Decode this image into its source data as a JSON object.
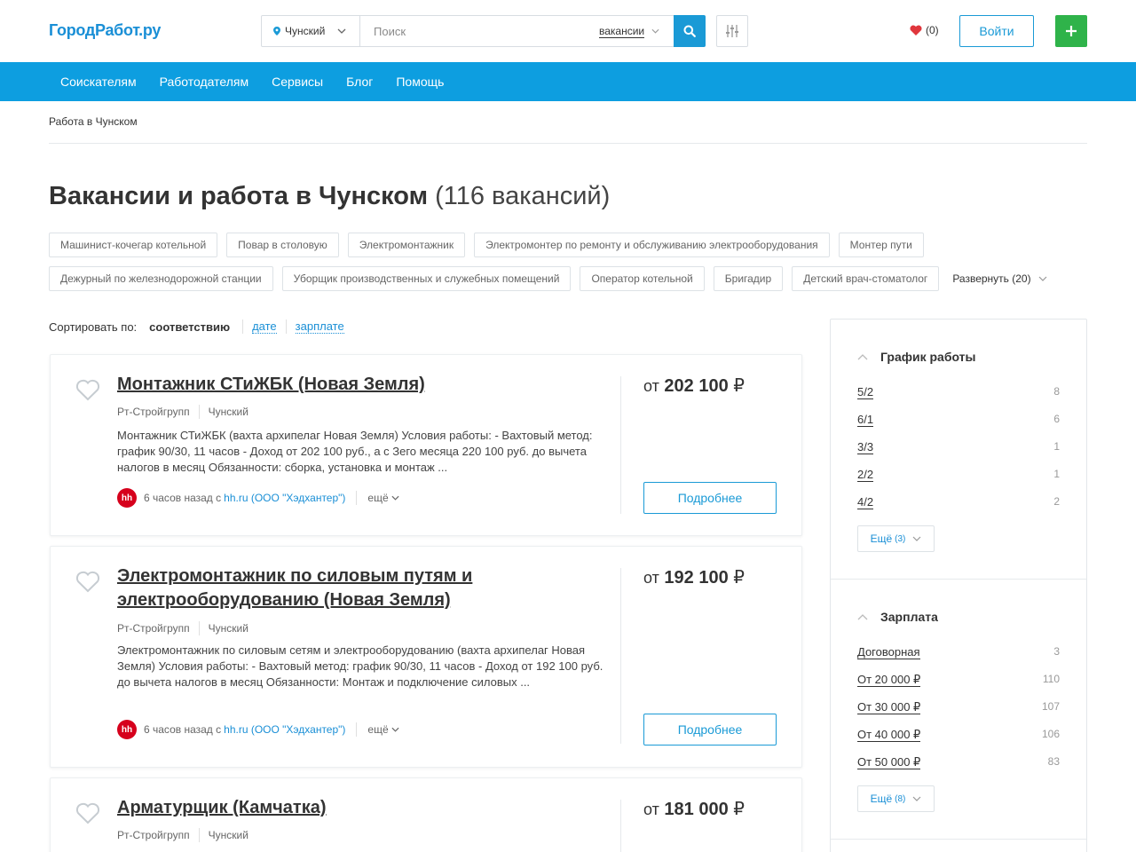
{
  "header": {
    "logo": "ГородРабот.ру",
    "city": "Чунский",
    "search_placeholder": "Поиск",
    "search_type": "вакансии",
    "favorites_count": "(0)",
    "login_label": "Войти",
    "colors": {
      "brand": "#1a9ad6",
      "add": "#2fb34a",
      "heart": "#e0363c"
    }
  },
  "nav": {
    "items": [
      "Соискателям",
      "Работодателям",
      "Сервисы",
      "Блог",
      "Помощь"
    ]
  },
  "breadcrumb": "Работа в Чунском",
  "page": {
    "title": "Вакансии и работа в Чунском",
    "count": "(116 вакансий)"
  },
  "tags": {
    "row1": [
      "Машинист-кочегар котельной",
      "Повар в столовую",
      "Электромонтажник",
      "Электромонтер по ремонту и обслуживанию электрооборудования",
      "Монтер пути"
    ],
    "row2": [
      "Дежурный по железнодорожной станции",
      "Уборщик производственных и служебных помещений",
      "Оператор котельной",
      "Бригадир",
      "Детский врач-стоматолог"
    ],
    "expand_label": "Развернуть (20)"
  },
  "sort": {
    "label": "Сортировать по:",
    "active": "соответствию",
    "options": [
      "дате",
      "зарплате"
    ]
  },
  "vacancies": [
    {
      "title": "Монтажник СТиЖБК (Новая Земля)",
      "company": "Рт-Стройгрупп",
      "city": "Чунский",
      "description": "Монтажник СТиЖБК (вахта архипелаг Новая Земля) Условия работы: - Вахтовый метод: график 90/30, 11 часов - Доход от 202 100 руб., а с Зего месяца 220 100 руб. до вычета налогов в месяц Обязанности: сборка, установка и монтаж ...",
      "time": "6 часов назад с",
      "source": "hh.ru (ООО \"Хэдхантер\")",
      "more": "ещё",
      "salary_from": "от",
      "salary": "202 100",
      "currency": "₽",
      "details": "Подробнее"
    },
    {
      "title": "Электромонтажник по силовым путям и электрооборудованию (Новая Земля)",
      "company": "Рт-Стройгрупп",
      "city": "Чунский",
      "description": "Электромонтажник по силовым сетям и электрооборудованию (вахта архипелаг Новая Земля) Условия работы: - Вахтовый метод: график 90/30, 11 часов - Доход от 192 100 руб. до вычета налогов в месяц Обязанности: Монтаж и подключение силовых ...",
      "time": "6 часов назад с",
      "source": "hh.ru (ООО \"Хэдхантер\")",
      "more": "ещё",
      "salary_from": "от",
      "salary": "192 100",
      "currency": "₽",
      "details": "Подробнее"
    },
    {
      "title": "Арматурщик (Камчатка)",
      "company": "Рт-Стройгрупп",
      "city": "Чунский",
      "salary_from": "от",
      "salary": "181 000",
      "currency": "₽"
    }
  ],
  "sidebar": {
    "schedule": {
      "title": "График работы",
      "items": [
        {
          "label": "5/2",
          "count": "8"
        },
        {
          "label": "6/1",
          "count": "6"
        },
        {
          "label": "3/3",
          "count": "1"
        },
        {
          "label": "2/2",
          "count": "1"
        },
        {
          "label": "4/2",
          "count": "2"
        }
      ],
      "more_label": "Ещё",
      "more_count": "(3)"
    },
    "salary": {
      "title": "Зарплата",
      "items": [
        {
          "label": "Договорная",
          "count": "3"
        },
        {
          "label": "От 20 000 ₽",
          "count": "110"
        },
        {
          "label": "От 30 000 ₽",
          "count": "107"
        },
        {
          "label": "От 40 000 ₽",
          "count": "106"
        },
        {
          "label": "От 50 000 ₽",
          "count": "83"
        }
      ],
      "more_label": "Ещё",
      "more_count": "(8)"
    }
  }
}
